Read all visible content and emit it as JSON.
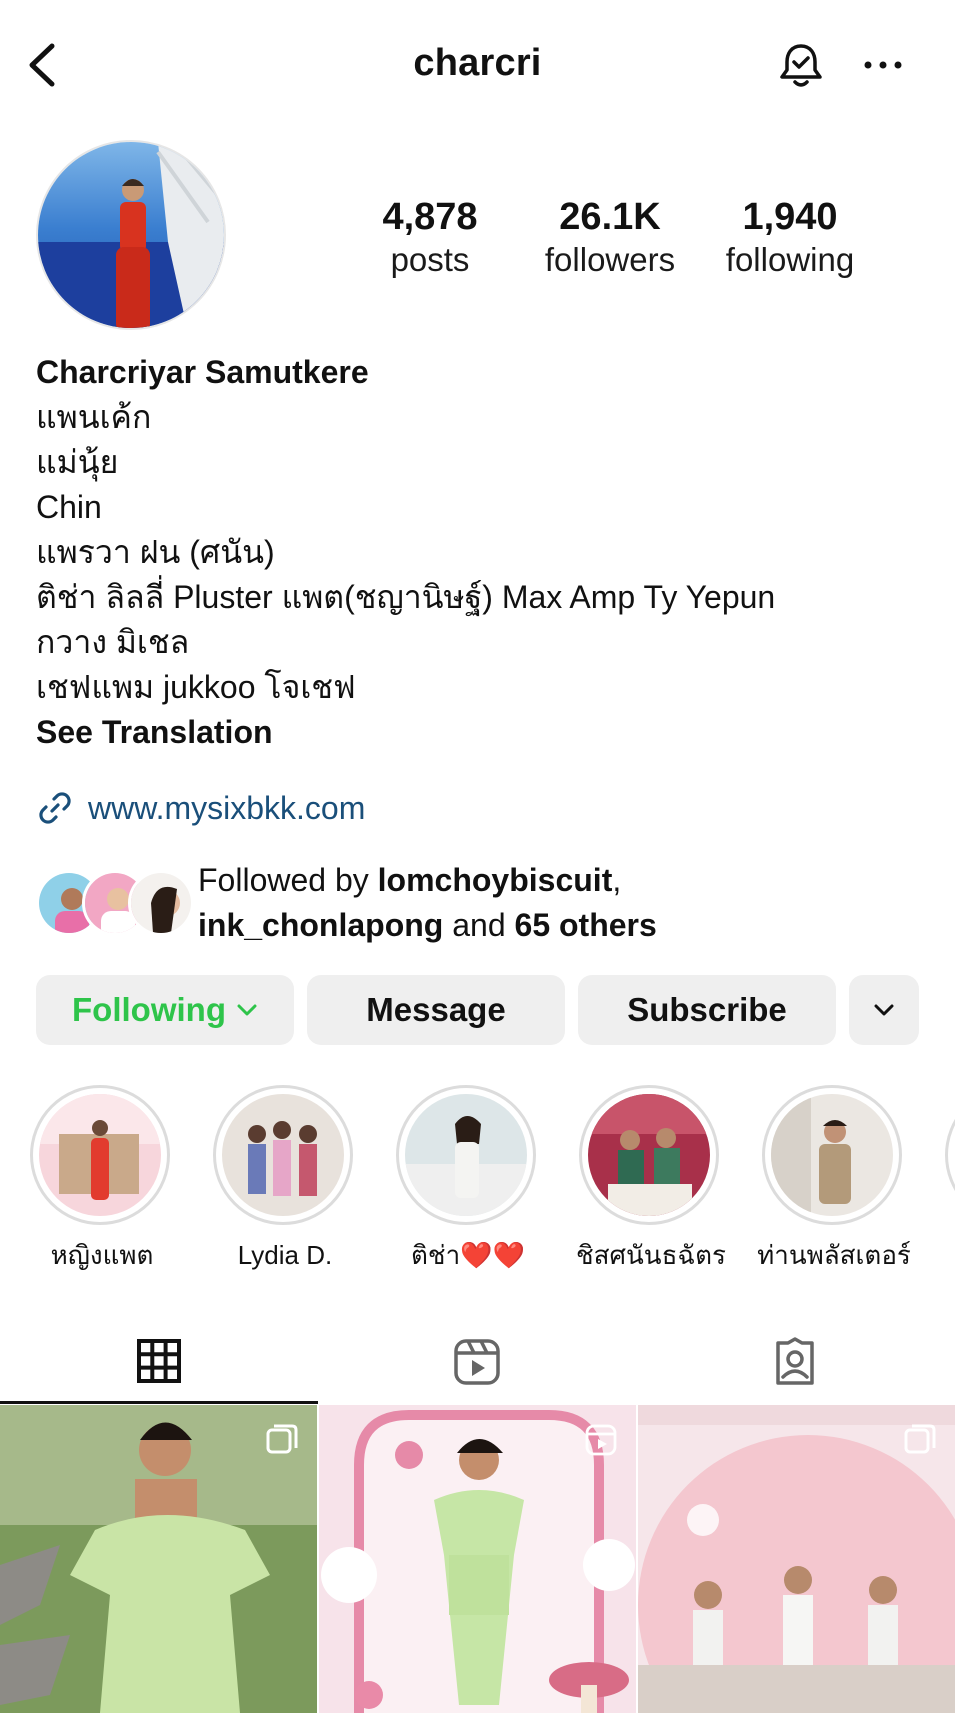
{
  "header": {
    "username": "charcri"
  },
  "stats": {
    "posts_count": "4,878",
    "posts_label": "posts",
    "followers_count": "26.1K",
    "followers_label": "followers",
    "following_count": "1,940",
    "following_label": "following"
  },
  "bio": {
    "name": "Charcriyar Samutkere",
    "lines": [
      "แพนเค้ก",
      "แม่นุ้ย",
      "Chin",
      "แพรวา ฝน (ศนัน)",
      "ติช่า ลิลลี่ Pluster แพต(ชญานิษฐ์) Max Amp Ty Yepun",
      "กวาง มิเชล",
      "เชฟแพม jukkoo โจเชฟ"
    ],
    "see_translation": "See Translation",
    "link": "www.mysixbkk.com"
  },
  "followed_by": {
    "prefix": "Followed by ",
    "user1": "lomchoybiscuit",
    "comma": ",",
    "user2": "ink_chonlapong",
    "and": " and ",
    "others": "65 others"
  },
  "buttons": {
    "following": "Following",
    "message": "Message",
    "subscribe": "Subscribe"
  },
  "highlights": [
    {
      "label": "หญิงแพต"
    },
    {
      "label": "Lydia D."
    },
    {
      "label": "ติช่า❤️❤️"
    },
    {
      "label": "ชิสศนันธฉัตร"
    },
    {
      "label": "ท่านพลัสเตอร์"
    }
  ],
  "colors": {
    "following_green": "#2ec44a",
    "link_blue": "#1a4f7a",
    "button_bg": "#efefef"
  },
  "icons": {
    "back": "chevron-left-icon",
    "bell": "notification-bell-icon",
    "more": "more-dots-icon",
    "link": "link-icon",
    "grid_tab": "grid-icon",
    "reels_tab": "reels-icon",
    "tagged_tab": "tagged-icon"
  }
}
